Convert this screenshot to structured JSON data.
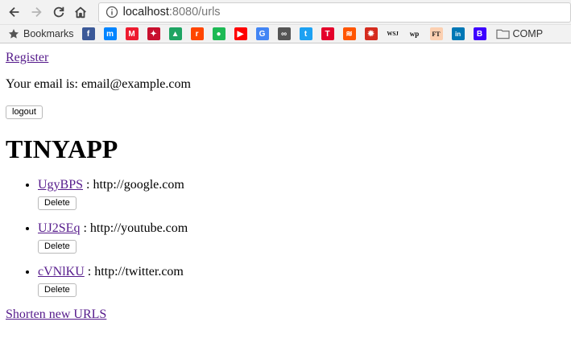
{
  "browser": {
    "url_host": "localhost",
    "url_path": ":8080/urls",
    "bookmarks_label": "Bookmarks",
    "bookmark_icons": [
      {
        "name": "facebook-icon",
        "glyph": "f",
        "bg": "#3b5998"
      },
      {
        "name": "messenger-icon",
        "glyph": "m",
        "bg": "#0084ff"
      },
      {
        "name": "mcgill-icon",
        "glyph": "M",
        "bg": "#ed1b2f"
      },
      {
        "name": "cardinal-bird-icon",
        "glyph": "✦",
        "bg": "#c8102e"
      },
      {
        "name": "google-drive-icon",
        "glyph": "▲",
        "bg": "#1fa463"
      },
      {
        "name": "reddit-icon",
        "glyph": "r",
        "bg": "#ff4500"
      },
      {
        "name": "green-circle-icon",
        "glyph": "●",
        "bg": "#1db954"
      },
      {
        "name": "youtube-icon",
        "glyph": "▶",
        "bg": "#ff0000"
      },
      {
        "name": "google-icon",
        "glyph": "G",
        "bg": "#4285f4"
      },
      {
        "name": "link-icon",
        "glyph": "∞",
        "bg": "#555555"
      },
      {
        "name": "twitter-icon",
        "glyph": "t",
        "bg": "#1da1f2"
      },
      {
        "name": "t-icon",
        "glyph": "T",
        "bg": "#e4002b"
      },
      {
        "name": "soundcloud-icon",
        "glyph": "≋",
        "bg": "#ff5500"
      },
      {
        "name": "maple-leaf-icon",
        "glyph": "✹",
        "bg": "#d52b1e"
      },
      {
        "name": "wsj-icon",
        "glyph": "WSJ",
        "bg": "#f2f2f2"
      },
      {
        "name": "washington-post-icon",
        "glyph": "wp",
        "bg": "#f2f2f2"
      },
      {
        "name": "financial-times-icon",
        "glyph": "FT",
        "bg": "#fcd0b1"
      },
      {
        "name": "linkedin-icon",
        "glyph": "in",
        "bg": "#0077b5"
      },
      {
        "name": "b-icon",
        "glyph": "B",
        "bg": "#3d00ff"
      }
    ],
    "folder_label": "COMP"
  },
  "page": {
    "register_link": "Register",
    "email_prefix": "Your email is: ",
    "email": "email@example.com",
    "logout_label": "logout",
    "title": "TINYAPP",
    "urls": [
      {
        "short": "UgyBPS",
        "long": "http://google.com",
        "delete_label": "Delete"
      },
      {
        "short": "UJ2SEq",
        "long": "http://youtube.com",
        "delete_label": "Delete"
      },
      {
        "short": "cVNlKU",
        "long": "http://twitter.com",
        "delete_label": "Delete"
      }
    ],
    "separator": " : ",
    "shorten_link": "Shorten new URLS"
  },
  "colors": {
    "link_visited": "#551a8b",
    "chrome_bg": "#f2f2f2"
  }
}
